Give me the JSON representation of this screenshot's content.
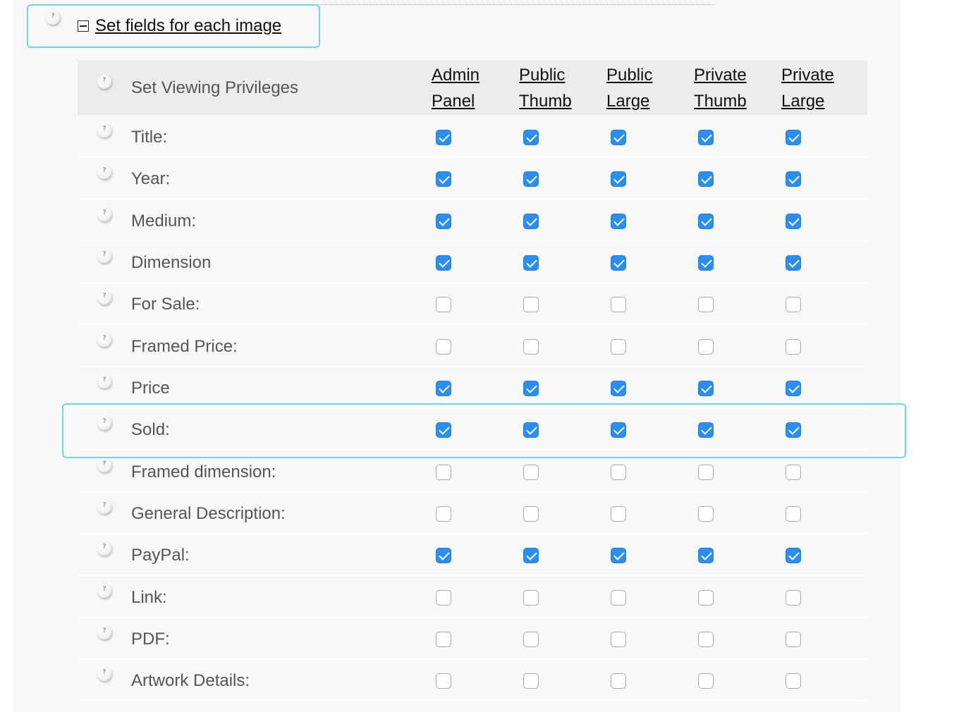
{
  "section": {
    "title": "Set fields for each image",
    "toggle_icon": "minus-square-icon"
  },
  "header": {
    "label": "Set Viewing Privileges",
    "columns": [
      {
        "line1": "Admin",
        "line2": "Panel"
      },
      {
        "line1": "Public",
        "line2": "Thumb"
      },
      {
        "line1": "Public",
        "line2": "Large"
      },
      {
        "line1": "Private",
        "line2": "Thumb"
      },
      {
        "line1": "Private",
        "line2": "Large"
      }
    ]
  },
  "rows": [
    {
      "label": "Title:",
      "checked": [
        true,
        true,
        true,
        true,
        true
      ]
    },
    {
      "label": "Year:",
      "checked": [
        true,
        true,
        true,
        true,
        true
      ]
    },
    {
      "label": "Medium:",
      "checked": [
        true,
        true,
        true,
        true,
        true
      ]
    },
    {
      "label": "Dimension",
      "checked": [
        true,
        true,
        true,
        true,
        true
      ]
    },
    {
      "label": "For Sale:",
      "checked": [
        false,
        false,
        false,
        false,
        false
      ]
    },
    {
      "label": "Framed Price:",
      "checked": [
        false,
        false,
        false,
        false,
        false
      ]
    },
    {
      "label": "Price",
      "checked": [
        true,
        true,
        true,
        true,
        true
      ]
    },
    {
      "label": "Sold:",
      "checked": [
        true,
        true,
        true,
        true,
        true
      ],
      "highlighted": true
    },
    {
      "label": "Framed dimension:",
      "checked": [
        false,
        false,
        false,
        false,
        false
      ]
    },
    {
      "label": "General Description:",
      "checked": [
        false,
        false,
        false,
        false,
        false
      ]
    },
    {
      "label": "PayPal:",
      "checked": [
        true,
        true,
        true,
        true,
        true
      ]
    },
    {
      "label": "Link:",
      "checked": [
        false,
        false,
        false,
        false,
        false
      ]
    },
    {
      "label": "PDF:",
      "checked": [
        false,
        false,
        false,
        false,
        false
      ]
    },
    {
      "label": "Artwork Details:",
      "checked": [
        false,
        false,
        false,
        false,
        false
      ]
    }
  ],
  "colors": {
    "accent_checkbox": "#2b8ef3",
    "highlight_border": "#6fd3ea"
  }
}
